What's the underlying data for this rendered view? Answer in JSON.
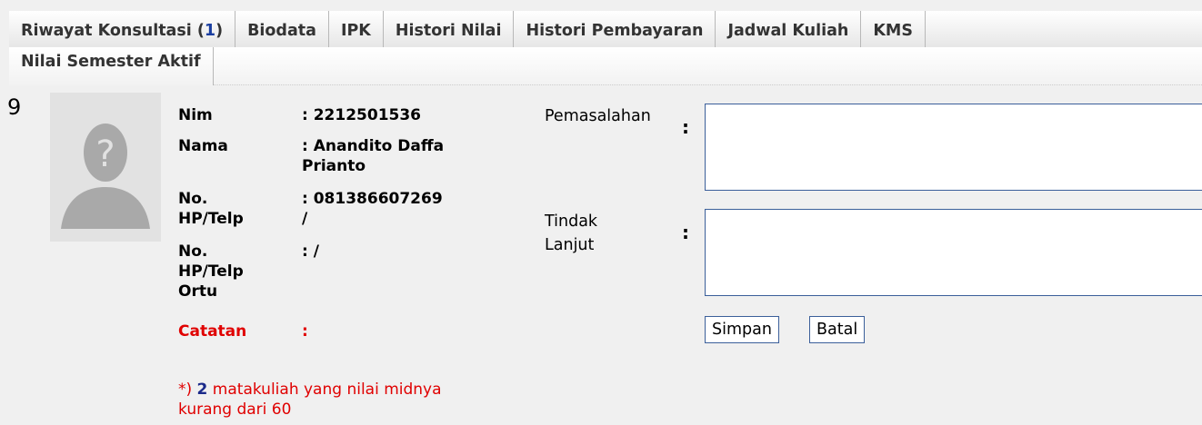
{
  "tabs": {
    "riwayat_label": "Riwayat Konsultasi (",
    "riwayat_count": "1",
    "riwayat_close": ")",
    "biodata": "Biodata",
    "ipk": "IPK",
    "histori_nilai": "Histori Nilai",
    "histori_pembayaran": "Histori Pembayaran",
    "jadwal_kuliah": "Jadwal Kuliah",
    "kms": "KMS",
    "nilai_semester_aktif": "Nilai Semester Aktif"
  },
  "record": {
    "number": "9",
    "nim_label": "Nim",
    "nim_value": ": 2212501536",
    "nama_label": "Nama",
    "nama_value_1": ": Anandito Daffa",
    "nama_value_2": "Prianto",
    "hp_label_1": "No.",
    "hp_label_2": "HP/Telp",
    "hp_value_1": ": 081386607269",
    "hp_value_2": "/",
    "hportu_label_1": "No.",
    "hportu_label_2": "HP/Telp",
    "hportu_label_3": "Ortu",
    "hportu_value": ": /",
    "catatan_label": "Catatan",
    "catatan_value": ":",
    "note_prefix": "*)",
    "note_count": "2",
    "note_text_1": "matakuliah yang nilai midnya",
    "note_text_2": "kurang dari 60"
  },
  "form": {
    "pemasalahan_label": "Pemasalahan",
    "tindak_label_1": "Tindak",
    "tindak_label_2": "Lanjut",
    "colon": ":",
    "pemasalahan_value": "",
    "tindak_value": "",
    "simpan": "Simpan",
    "batal": "Batal"
  }
}
